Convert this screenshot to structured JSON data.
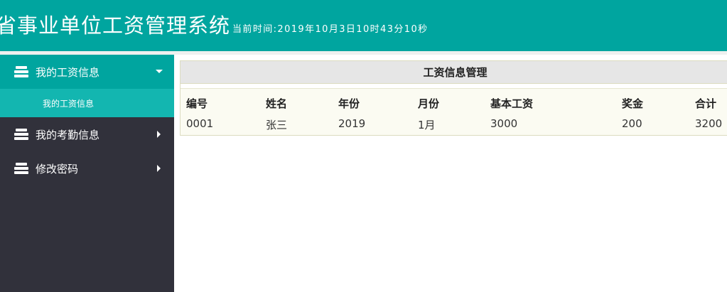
{
  "header": {
    "title": "省事业单位工资管理系统",
    "time_text": "当前时间:2019年10月3日10时43分10秒"
  },
  "sidebar": {
    "items": [
      {
        "label": "我的工资信息",
        "expanded": true,
        "icon": "stack-icon"
      },
      {
        "label": "我的考勤信息",
        "expanded": false,
        "icon": "stack-icon"
      },
      {
        "label": "修改密码",
        "expanded": false,
        "icon": "stack-icon"
      }
    ],
    "submenu": [
      {
        "label": "我的工资信息"
      }
    ]
  },
  "main": {
    "panel_title": "工资信息管理",
    "columns": [
      "编号",
      "姓名",
      "年份",
      "月份",
      "基本工资",
      "奖金",
      "合计"
    ],
    "rows": [
      [
        "0001",
        "张三",
        "2019",
        "1月",
        "3000",
        "200",
        "3200"
      ]
    ]
  },
  "colors": {
    "brand": "#00a59f",
    "submenu": "#13b6b0",
    "sidebar_bg": "#31313b"
  }
}
